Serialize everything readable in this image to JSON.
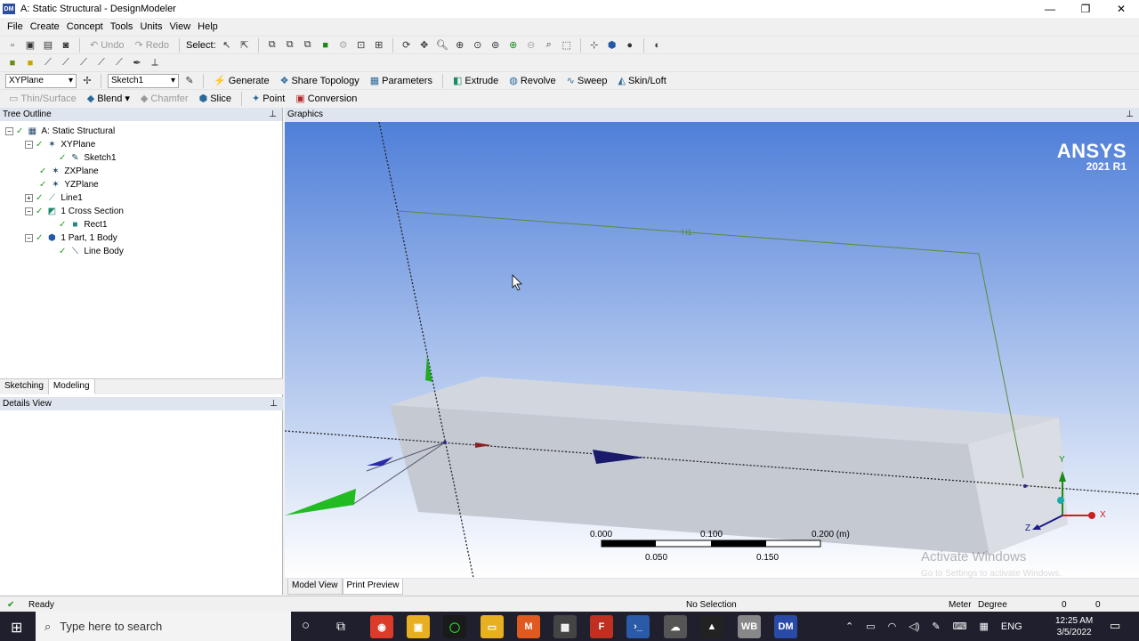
{
  "window": {
    "title": "A: Static Structural - DesignModeler",
    "app_icon": "DM",
    "minimize": "—",
    "maximize": "❐",
    "close": "✕"
  },
  "menu": [
    "File",
    "Create",
    "Concept",
    "Tools",
    "Units",
    "View",
    "Help"
  ],
  "toolbar1": {
    "undo": "Undo",
    "redo": "Redo",
    "select_label": "Select:"
  },
  "toolbar3": {
    "plane_combo": "XYPlane",
    "sketch_combo": "Sketch1",
    "generate": "Generate",
    "share_topology": "Share Topology",
    "parameters": "Parameters",
    "extrude": "Extrude",
    "revolve": "Revolve",
    "sweep": "Sweep",
    "skin_loft": "Skin/Loft"
  },
  "toolbar4": {
    "thin_surface": "Thin/Surface",
    "blend": "Blend",
    "chamfer": "Chamfer",
    "slice": "Slice",
    "point": "Point",
    "conversion": "Conversion"
  },
  "tree": {
    "header": "Tree Outline",
    "items": [
      {
        "label": "A: Static Structural"
      },
      {
        "label": "XYPlane"
      },
      {
        "label": "Sketch1"
      },
      {
        "label": "ZXPlane"
      },
      {
        "label": "YZPlane"
      },
      {
        "label": "Line1"
      },
      {
        "label": "1 Cross Section"
      },
      {
        "label": "Rect1"
      },
      {
        "label": "1 Part, 1 Body"
      },
      {
        "label": "Line Body"
      }
    ]
  },
  "left_tabs": [
    "Sketching",
    "Modeling"
  ],
  "details": {
    "header": "Details View"
  },
  "graphics": {
    "header": "Graphics",
    "brand": "ANSYS",
    "version": "2021 R1",
    "sketch_label": "H1",
    "scale_ticks_top": [
      "0.000",
      "0.100",
      "0.200 (m)"
    ],
    "scale_ticks_bottom": [
      "0.050",
      "0.150"
    ],
    "axes": {
      "x": "X",
      "y": "Y",
      "z": "Z"
    },
    "tabs": [
      "Model View",
      "Print Preview"
    ],
    "watermark": "Activate Windows",
    "watermark_sub": "Go to Settings to activate Windows."
  },
  "status": {
    "state": "Ready",
    "selection": "No Selection",
    "unit_length": "Meter",
    "unit_angle": "Degree",
    "v1": "0",
    "v2": "0"
  },
  "taskbar": {
    "search_placeholder": "Type here to search",
    "lang": "ENG",
    "time": "12:25 AM",
    "date": "3/5/2022"
  }
}
